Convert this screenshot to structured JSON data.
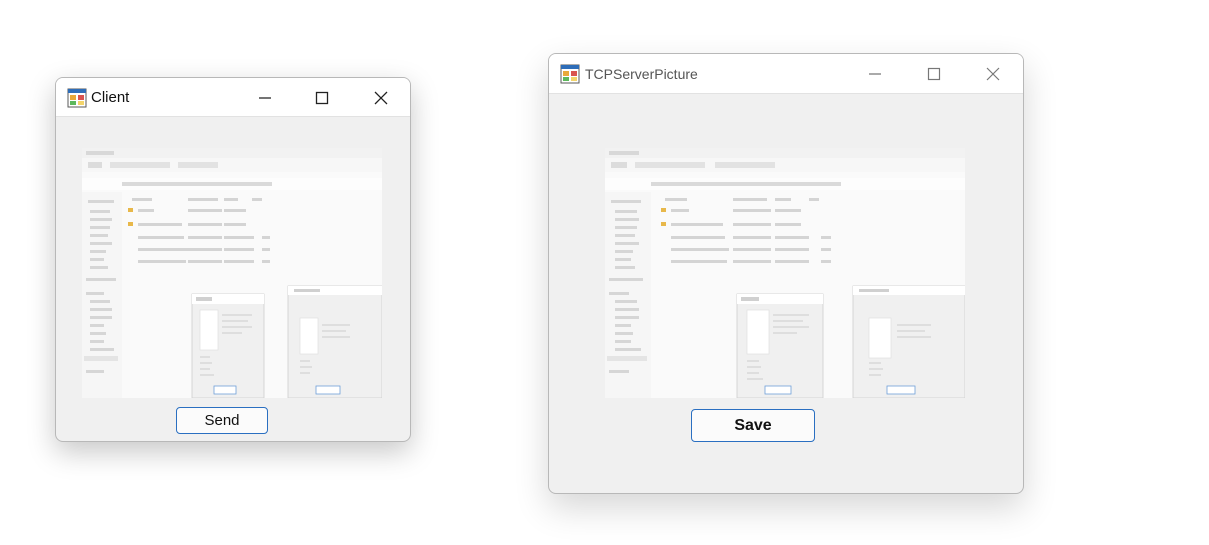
{
  "client_window": {
    "title": "Client",
    "icon": "form-app-icon",
    "controls": {
      "minimize": "minimize-icon",
      "maximize": "maximize-icon",
      "close": "close-icon"
    },
    "send_label": "Send"
  },
  "server_window": {
    "title": "TCPServerPicture",
    "icon": "form-app-icon",
    "controls": {
      "minimize": "minimize-icon",
      "maximize": "maximize-icon",
      "close": "close-icon"
    },
    "save_label": "Save"
  },
  "colors": {
    "button_border": "#2a6fc1",
    "window_body": "#f0f0f0",
    "titlebar": "#ffffff"
  }
}
